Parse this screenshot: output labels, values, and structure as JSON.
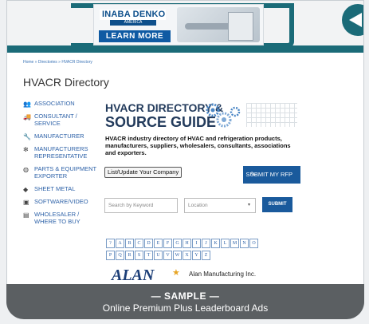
{
  "banner": {
    "brand": "INABA DENKO",
    "brand_sub": "AMERICA",
    "cta": "LEARN MORE"
  },
  "breadcrumb": "Home » Directories » HVACR Directory",
  "page_title": "HVACR Directory",
  "sidebar": {
    "items": [
      {
        "label": "ASSOCIATION",
        "icon": "people-icon"
      },
      {
        "label": "CONSULTANT / SERVICE",
        "icon": "truck-icon"
      },
      {
        "label": "MANUFACTURER",
        "icon": "wrench-icon"
      },
      {
        "label": "MANUFACTURERS REPRESENTATIVE",
        "icon": "fan-icon"
      },
      {
        "label": "PARTS & EQUIPMENT EXPORTER",
        "icon": "globe-icon"
      },
      {
        "label": "SHEET METAL",
        "icon": "layers-icon"
      },
      {
        "label": "SOFTWARE/VIDEO",
        "icon": "monitor-icon"
      },
      {
        "label": "WHOLESALER / WHERE TO BUY",
        "icon": "warehouse-icon"
      }
    ]
  },
  "guide": {
    "title_line1": "HVACR DIRECTORY &",
    "title_line2": "SOURCE GUIDE",
    "description": "HVACR industry directory of HVAC and refrigeration products, manufacturers, suppliers, wholesalers, consultants, associations and exporters."
  },
  "buttons": {
    "list_company": "List/Update Your Company",
    "submit_rfp": "SUBMIT MY RFP",
    "submit": "SUBMIT"
  },
  "search": {
    "keyword_placeholder": "Search by Keyword",
    "location_placeholder": "Location"
  },
  "alphabet": {
    "row1": [
      "?",
      "A",
      "B",
      "C",
      "D",
      "E",
      "F",
      "G",
      "H",
      "I",
      "J",
      "K",
      "L",
      "M",
      "N",
      "O"
    ],
    "row2": [
      "P",
      "Q",
      "R",
      "S",
      "T",
      "U",
      "V",
      "W",
      "X",
      "Y",
      "Z"
    ]
  },
  "listing": {
    "logo_text": "ALAN",
    "name": "Alan Manufacturing Inc."
  },
  "sample_note": {
    "line1": "— SAMPLE —",
    "line2": "Online Premium Plus Leaderboard Ads"
  },
  "colors": {
    "teal": "#1b6b78",
    "link_blue": "#2e62a8",
    "button_blue": "#1a5a9c"
  }
}
